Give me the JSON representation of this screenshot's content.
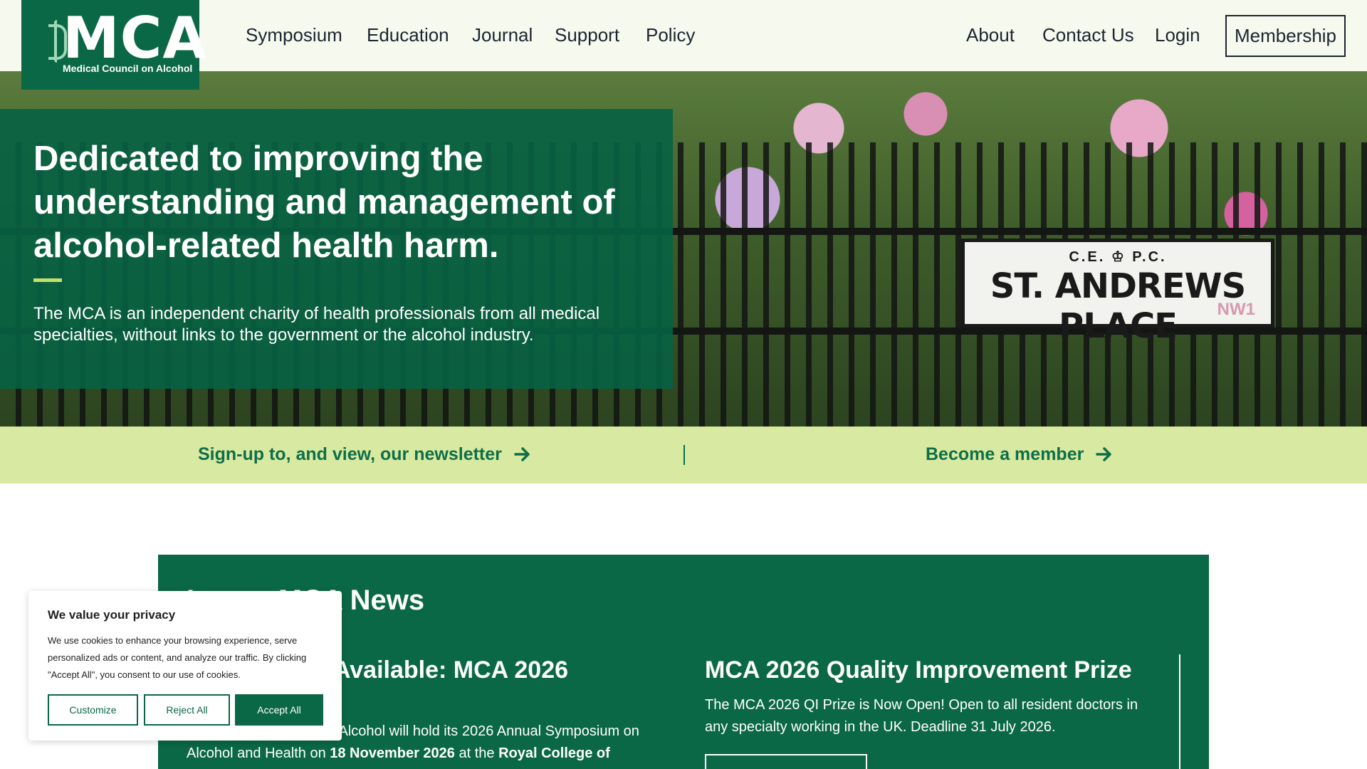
{
  "logo": {
    "text": "MCA",
    "subtitle": "Medical Council on Alcohol"
  },
  "nav": {
    "main": [
      "Symposium",
      "Education",
      "Journal",
      "Support",
      "Policy"
    ],
    "secondary": [
      "About",
      "Contact Us",
      "Login"
    ],
    "membership": "Membership"
  },
  "hero": {
    "title": "Dedicated to improving the understanding and management of alcohol-related health harm.",
    "text": "The MCA is an independent charity of health professionals from all medical specialties, without links to the government or the alcohol industry.",
    "sign": {
      "top": "C.E. ♔ P.C.",
      "name": "ST. ANDREWS PLACE",
      "code": "NW1"
    }
  },
  "cta": {
    "newsletter": "Sign-up to, and view, our newsletter",
    "member": "Become a member"
  },
  "news": {
    "heading": "Latest MCA News",
    "items": [
      {
        "title": "Tickets Now Available: MCA 2026",
        "text_a": "The Medical Council on Alcohol will hold its 2026 Annual Symposium on Alcohol and Health on ",
        "date": "18 November 2026",
        "text_b": " at the ",
        "venue": "Royal College of"
      },
      {
        "title": "MCA 2026 Quality Improvement Prize",
        "text": "The MCA 2026 QI Prize is Now Open!  Open to all resident doctors in any specialty working in the UK.  Deadline 31 July 2026."
      }
    ]
  },
  "cookie": {
    "title": "We value your privacy",
    "text": "We use cookies to enhance your browsing experience, serve personalized ads or content, and analyze our traffic. By clicking \"Accept All\", you consent to our use of cookies.",
    "customize": "Customize",
    "reject": "Reject All",
    "accept": "Accept All"
  },
  "colors": {
    "brand": "#0b6846",
    "accent": "#c5e069",
    "band": "#d8eaa1"
  }
}
